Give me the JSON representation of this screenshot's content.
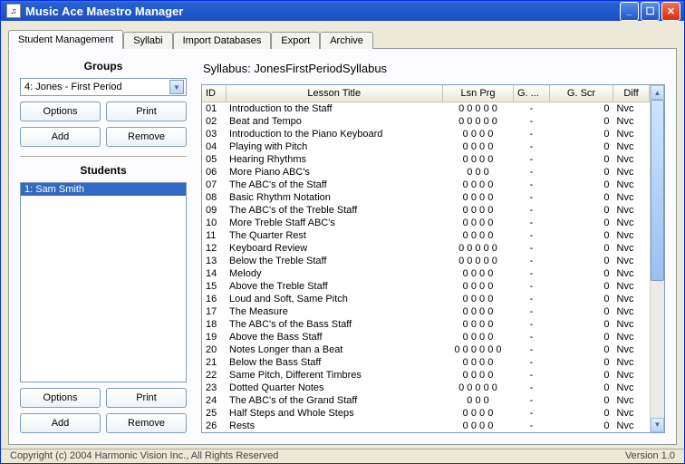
{
  "window": {
    "title": "Music Ace Maestro Manager"
  },
  "tabs": [
    {
      "label": "Student Management",
      "active": true
    },
    {
      "label": "Syllabi"
    },
    {
      "label": "Import Databases"
    },
    {
      "label": "Export"
    },
    {
      "label": "Archive"
    }
  ],
  "groups": {
    "title": "Groups",
    "selected": "4: Jones - First Period",
    "buttons": {
      "options": "Options",
      "print": "Print",
      "add": "Add",
      "remove": "Remove"
    }
  },
  "students": {
    "title": "Students",
    "items": [
      {
        "label": "1:  Sam Smith",
        "selected": true
      }
    ],
    "buttons": {
      "options": "Options",
      "print": "Print",
      "add": "Add",
      "remove": "Remove"
    }
  },
  "syllabus": {
    "prefix": "Syllabus:  ",
    "name": "JonesFirstPeriodSyllabus"
  },
  "table": {
    "headers": {
      "id": "ID",
      "title": "Lesson Title",
      "lsnprg": "Lsn Prg",
      "g1": "G. ...",
      "gscr": "G. Scr",
      "diff": "Diff"
    },
    "rows": [
      {
        "id": "01",
        "title": "Introduction to the Staff",
        "lsnprg": "0 0 0 0 0",
        "g1": "-",
        "gscr": "0",
        "diff": "Nvc"
      },
      {
        "id": "02",
        "title": "Beat and Tempo",
        "lsnprg": "0 0 0 0 0",
        "g1": "-",
        "gscr": "0",
        "diff": "Nvc"
      },
      {
        "id": "03",
        "title": "Introduction to the Piano Keyboard",
        "lsnprg": "0 0 0 0",
        "g1": "-",
        "gscr": "0",
        "diff": "Nvc"
      },
      {
        "id": "04",
        "title": "Playing with Pitch",
        "lsnprg": "0 0 0 0",
        "g1": "-",
        "gscr": "0",
        "diff": "Nvc"
      },
      {
        "id": "05",
        "title": "Hearing Rhythms",
        "lsnprg": "0 0 0 0",
        "g1": "-",
        "gscr": "0",
        "diff": "Nvc"
      },
      {
        "id": "06",
        "title": "More Piano ABC's",
        "lsnprg": "0 0 0",
        "g1": "-",
        "gscr": "0",
        "diff": "Nvc"
      },
      {
        "id": "07",
        "title": "The ABC's of the Staff",
        "lsnprg": "0 0 0 0",
        "g1": "-",
        "gscr": "0",
        "diff": "Nvc"
      },
      {
        "id": "08",
        "title": "Basic Rhythm Notation",
        "lsnprg": "0 0 0 0",
        "g1": "-",
        "gscr": "0",
        "diff": "Nvc"
      },
      {
        "id": "09",
        "title": "The ABC's of the Treble Staff",
        "lsnprg": "0 0 0 0",
        "g1": "-",
        "gscr": "0",
        "diff": "Nvc"
      },
      {
        "id": "10",
        "title": "More Treble Staff ABC's",
        "lsnprg": "0 0 0 0",
        "g1": "-",
        "gscr": "0",
        "diff": "Nvc"
      },
      {
        "id": "11",
        "title": "The Quarter Rest",
        "lsnprg": "0 0 0 0",
        "g1": "-",
        "gscr": "0",
        "diff": "Nvc"
      },
      {
        "id": "12",
        "title": "Keyboard Review",
        "lsnprg": "0 0 0 0 0",
        "g1": "-",
        "gscr": "0",
        "diff": "Nvc"
      },
      {
        "id": "13",
        "title": "Below the Treble Staff",
        "lsnprg": "0 0 0 0 0",
        "g1": "-",
        "gscr": "0",
        "diff": "Nvc"
      },
      {
        "id": "14",
        "title": "Melody",
        "lsnprg": "0 0 0 0",
        "g1": "-",
        "gscr": "0",
        "diff": "Nvc"
      },
      {
        "id": "15",
        "title": "Above the Treble Staff",
        "lsnprg": "0 0 0 0",
        "g1": "-",
        "gscr": "0",
        "diff": "Nvc"
      },
      {
        "id": "16",
        "title": "Loud and Soft, Same Pitch",
        "lsnprg": "0 0 0 0",
        "g1": "-",
        "gscr": "0",
        "diff": "Nvc"
      },
      {
        "id": "17",
        "title": "The Measure",
        "lsnprg": "0 0 0 0",
        "g1": "-",
        "gscr": "0",
        "diff": "Nvc"
      },
      {
        "id": "18",
        "title": "The ABC's of the Bass Staff",
        "lsnprg": "0 0 0 0",
        "g1": "-",
        "gscr": "0",
        "diff": "Nvc"
      },
      {
        "id": "19",
        "title": "Above the Bass Staff",
        "lsnprg": "0 0 0 0",
        "g1": "-",
        "gscr": "0",
        "diff": "Nvc"
      },
      {
        "id": "20",
        "title": "Notes Longer than a Beat",
        "lsnprg": "0 0 0 0 0 0",
        "g1": "-",
        "gscr": "0",
        "diff": "Nvc"
      },
      {
        "id": "21",
        "title": "Below the Bass Staff",
        "lsnprg": "0 0 0 0",
        "g1": "-",
        "gscr": "0",
        "diff": "Nvc"
      },
      {
        "id": "22",
        "title": "Same Pitch, Different Timbres",
        "lsnprg": "0 0 0 0",
        "g1": "-",
        "gscr": "0",
        "diff": "Nvc"
      },
      {
        "id": "23",
        "title": "Dotted Quarter Notes",
        "lsnprg": "0 0 0 0 0",
        "g1": "-",
        "gscr": "0",
        "diff": "Nvc"
      },
      {
        "id": "24",
        "title": "The ABC's of the Grand Staff",
        "lsnprg": "0 0 0",
        "g1": "-",
        "gscr": "0",
        "diff": "Nvc"
      },
      {
        "id": "25",
        "title": "Half Steps and Whole Steps",
        "lsnprg": "0 0 0 0",
        "g1": "-",
        "gscr": "0",
        "diff": "Nvc"
      },
      {
        "id": "26",
        "title": "Rests",
        "lsnprg": "0 0 0 0",
        "g1": "-",
        "gscr": "0",
        "diff": "Nvc"
      }
    ]
  },
  "status": {
    "copyright": "Copyright (c) 2004 Harmonic Vision Inc., All Rights Reserved",
    "version": "Version 1.0"
  }
}
